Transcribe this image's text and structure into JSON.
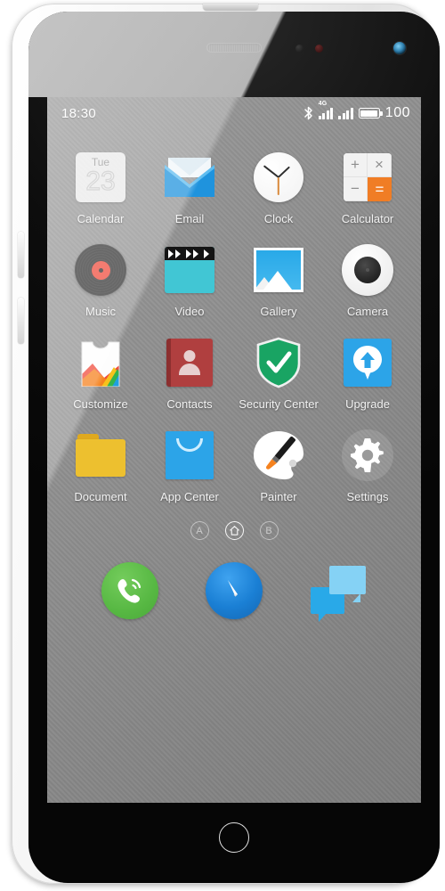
{
  "device": {
    "hardware": {
      "earpiece": "earpiece-speaker",
      "proximity_sensor": "proximity-sensor",
      "light_sensor": "light-sensor",
      "front_camera": "front-camera",
      "home_button": "home-button",
      "volume_up": "volume-up-button",
      "volume_down": "volume-down-button",
      "power": "power-button"
    }
  },
  "status_bar": {
    "time": "18:30",
    "bluetooth_icon": "bluetooth-icon",
    "network_label": "4G",
    "signal1_icon": "signal-bars-icon",
    "signal2_icon": "signal-bars-icon",
    "battery_icon": "battery-full-icon",
    "battery_percent": "100"
  },
  "home_screen": {
    "apps": [
      {
        "label": "Calendar",
        "icon": "calendar-icon",
        "dow": "Tue",
        "day": "23"
      },
      {
        "label": "Email",
        "icon": "email-envelope-icon"
      },
      {
        "label": "Clock",
        "icon": "clock-icon"
      },
      {
        "label": "Calculator",
        "icon": "calculator-icon",
        "keys": [
          "+",
          "×",
          "−",
          "="
        ]
      },
      {
        "label": "Music",
        "icon": "music-vinyl-icon"
      },
      {
        "label": "Video",
        "icon": "video-clapperboard-icon"
      },
      {
        "label": "Gallery",
        "icon": "gallery-photo-icon"
      },
      {
        "label": "Camera",
        "icon": "camera-lens-icon"
      },
      {
        "label": "Customize",
        "icon": "customize-tshirt-icon"
      },
      {
        "label": "Contacts",
        "icon": "contacts-book-icon"
      },
      {
        "label": "Security Center",
        "icon": "shield-check-icon"
      },
      {
        "label": "Upgrade",
        "icon": "upgrade-arrow-icon"
      },
      {
        "label": "Document",
        "icon": "folder-icon"
      },
      {
        "label": "App Center",
        "icon": "shopping-bag-icon"
      },
      {
        "label": "Painter",
        "icon": "paint-palette-icon"
      },
      {
        "label": "Settings",
        "icon": "gear-icon"
      }
    ],
    "page_indicator": [
      {
        "label": "A",
        "icon": "page-a-icon",
        "active": false
      },
      {
        "label": "",
        "icon": "home-page-icon",
        "active": true
      },
      {
        "label": "B",
        "icon": "page-b-icon",
        "active": false
      }
    ],
    "dock": [
      {
        "label": "Phone",
        "icon": "phone-handset-icon"
      },
      {
        "label": "Browser",
        "icon": "compass-browser-icon"
      },
      {
        "label": "Messages",
        "icon": "chat-bubbles-icon"
      }
    ]
  },
  "colors": {
    "accent_blue": "#2ca4e8",
    "accent_orange": "#f07d25",
    "accent_green": "#57b843",
    "accent_red": "#b03f3f",
    "accent_cyan": "#41c6d4",
    "accent_yellow": "#edc02f"
  }
}
